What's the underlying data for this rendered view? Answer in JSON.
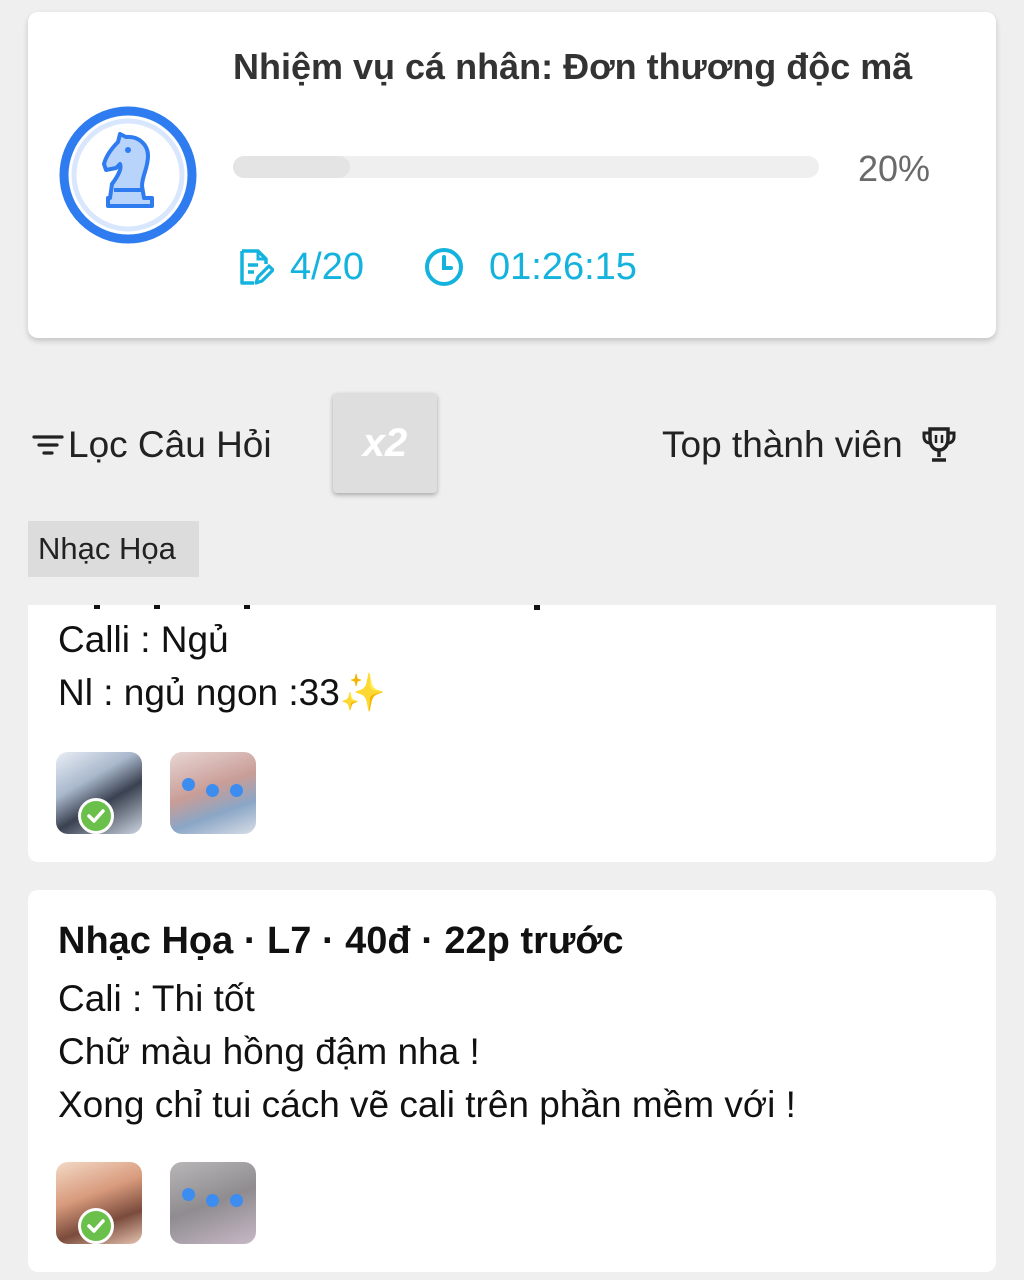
{
  "mission": {
    "title": "Nhiệm vụ cá nhân: Đơn thương độc mã",
    "progress_value": 0.2,
    "progress_text": "20%",
    "tasks": "4/20",
    "timer": "01:26:15",
    "badge_icon": "chess-knight-icon"
  },
  "toolbar": {
    "filter_label": "Lọc Câu Hỏi",
    "multiplier_label": "x2",
    "top_members_label": "Top thành viên"
  },
  "subject_tag": "Nhạc Họa",
  "posts": [
    {
      "lines": [
        "Calli : Ngủ",
        "Nl : ngủ ngon :33✨"
      ]
    },
    {
      "header": "Nhạc Họa · L7 · 40đ · 22p trước",
      "lines": [
        "Cali : Thi tốt",
        "Chữ màu hồng đậm nha !",
        "Xong chỉ tui cách vẽ cali trên phần mềm với !"
      ]
    }
  ],
  "colors": {
    "accent_cyan": "#14b3dd",
    "badge_blue": "#2f7cf0",
    "check_green": "#6bc04b",
    "background": "#efefef"
  }
}
